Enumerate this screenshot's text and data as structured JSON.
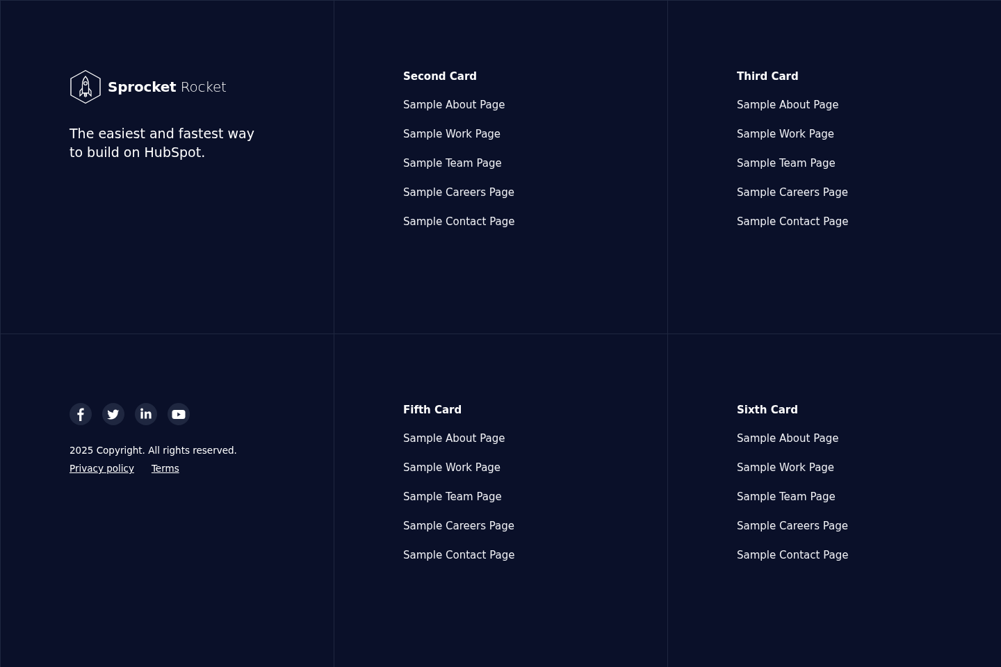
{
  "brand": {
    "name": "**Sprocket** Rocket",
    "tagline": "The easiest and fastest way to build on HubSpot."
  },
  "cards": [
    {
      "title": "Second Card",
      "links": [
        "Sample About Page",
        "Sample Work Page",
        "Sample Team Page",
        "Sample Careers Page",
        "Sample Contact Page"
      ]
    },
    {
      "title": "Third Card",
      "links": [
        "Sample About Page",
        "Sample Work Page",
        "Sample Team Page",
        "Sample Careers Page",
        "Sample Contact Page"
      ]
    },
    {
      "title": "Fifth Card",
      "links": [
        "Sample About Page",
        "Sample Work Page",
        "Sample Team Page",
        "Sample Careers Page",
        "Sample Contact Page"
      ]
    },
    {
      "title": "Sixth Card",
      "links": [
        "Sample About Page",
        "Sample Work Page",
        "Sample Team Page",
        "Sample Careers Page",
        "Sample Contact Page"
      ]
    }
  ],
  "footer": {
    "copyright": "2025 Copyright. All rights reserved.",
    "legal_links": [
      "Privacy policy",
      "Terms"
    ]
  }
}
